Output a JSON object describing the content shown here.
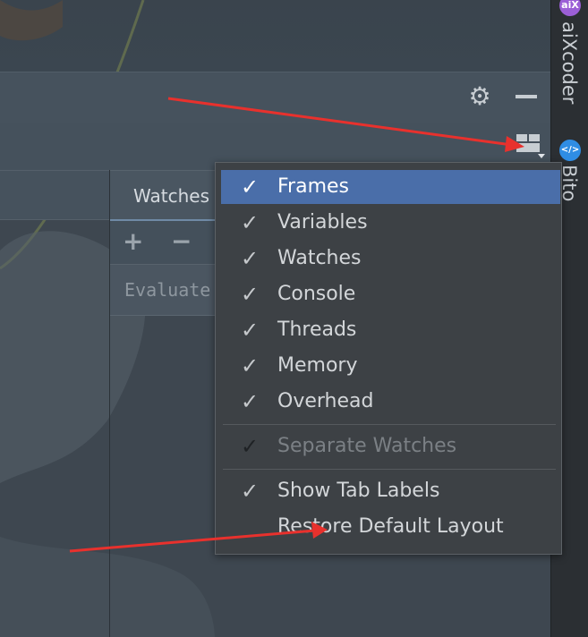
{
  "window": {
    "settings_icon": "gear-icon",
    "minimize_icon": "minimize-icon",
    "layout_icon": "layout-settings-icon"
  },
  "watches_panel": {
    "tab_label": "Watches",
    "add_label": "+",
    "remove_label": "−",
    "evaluate_placeholder": "Evaluate expression"
  },
  "right_strip": {
    "plugins": [
      {
        "badge": "aiX",
        "label": "aiXcoder",
        "badge_color": "#9b5fd6"
      },
      {
        "badge": "</>",
        "label": "Bito",
        "badge_color": "#2f8de4"
      }
    ]
  },
  "layout_menu": {
    "items": [
      {
        "label": "Frames",
        "check": "✓"
      },
      {
        "label": "Variables",
        "check": "✓"
      },
      {
        "label": "Watches",
        "check": "✓"
      },
      {
        "label": "Console",
        "check": "✓"
      },
      {
        "label": "Threads",
        "check": "✓"
      },
      {
        "label": "Memory",
        "check": "✓"
      },
      {
        "label": "Overhead",
        "check": "✓"
      }
    ],
    "separate_watches": {
      "label": "Separate Watches",
      "check": "✓"
    },
    "show_tab_labels": {
      "label": "Show Tab Labels",
      "check": "✓"
    },
    "restore_layout": {
      "label": "Restore Default Layout"
    }
  },
  "colors": {
    "selection": "#4a6ea9",
    "annotation_arrow": "#e8312d",
    "menu_background": "#3d4145"
  }
}
